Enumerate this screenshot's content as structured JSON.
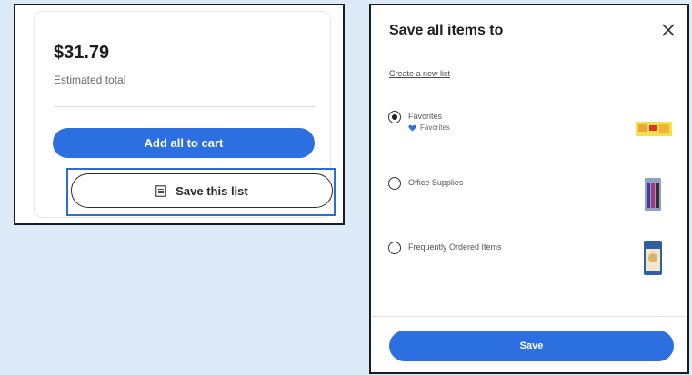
{
  "summary": {
    "total": "$31.79",
    "total_label": "Estimated total",
    "add_to_cart_label": "Add all to cart",
    "save_list_label": "Save this list"
  },
  "modal": {
    "title": "Save all items to",
    "create_link": "Create a new list",
    "options": [
      {
        "label": "Favorites",
        "sublabel": "Favorites",
        "selected": true,
        "thumb": "yellow-snack-pack"
      },
      {
        "label": "Office Supplies",
        "sublabel": "",
        "selected": false,
        "thumb": "pen-pack"
      },
      {
        "label": "Frequently Ordered Items",
        "sublabel": "",
        "selected": false,
        "thumb": "food-bag"
      }
    ],
    "save_label": "Save"
  },
  "colors": {
    "page_bg": "#dcebf7",
    "primary_button": "#2c6fe0",
    "highlight_border": "#2a6fcf",
    "heart": "#2c6fe0"
  },
  "icons": {
    "list": "list-icon",
    "close": "close-icon",
    "heart": "heart-icon"
  }
}
